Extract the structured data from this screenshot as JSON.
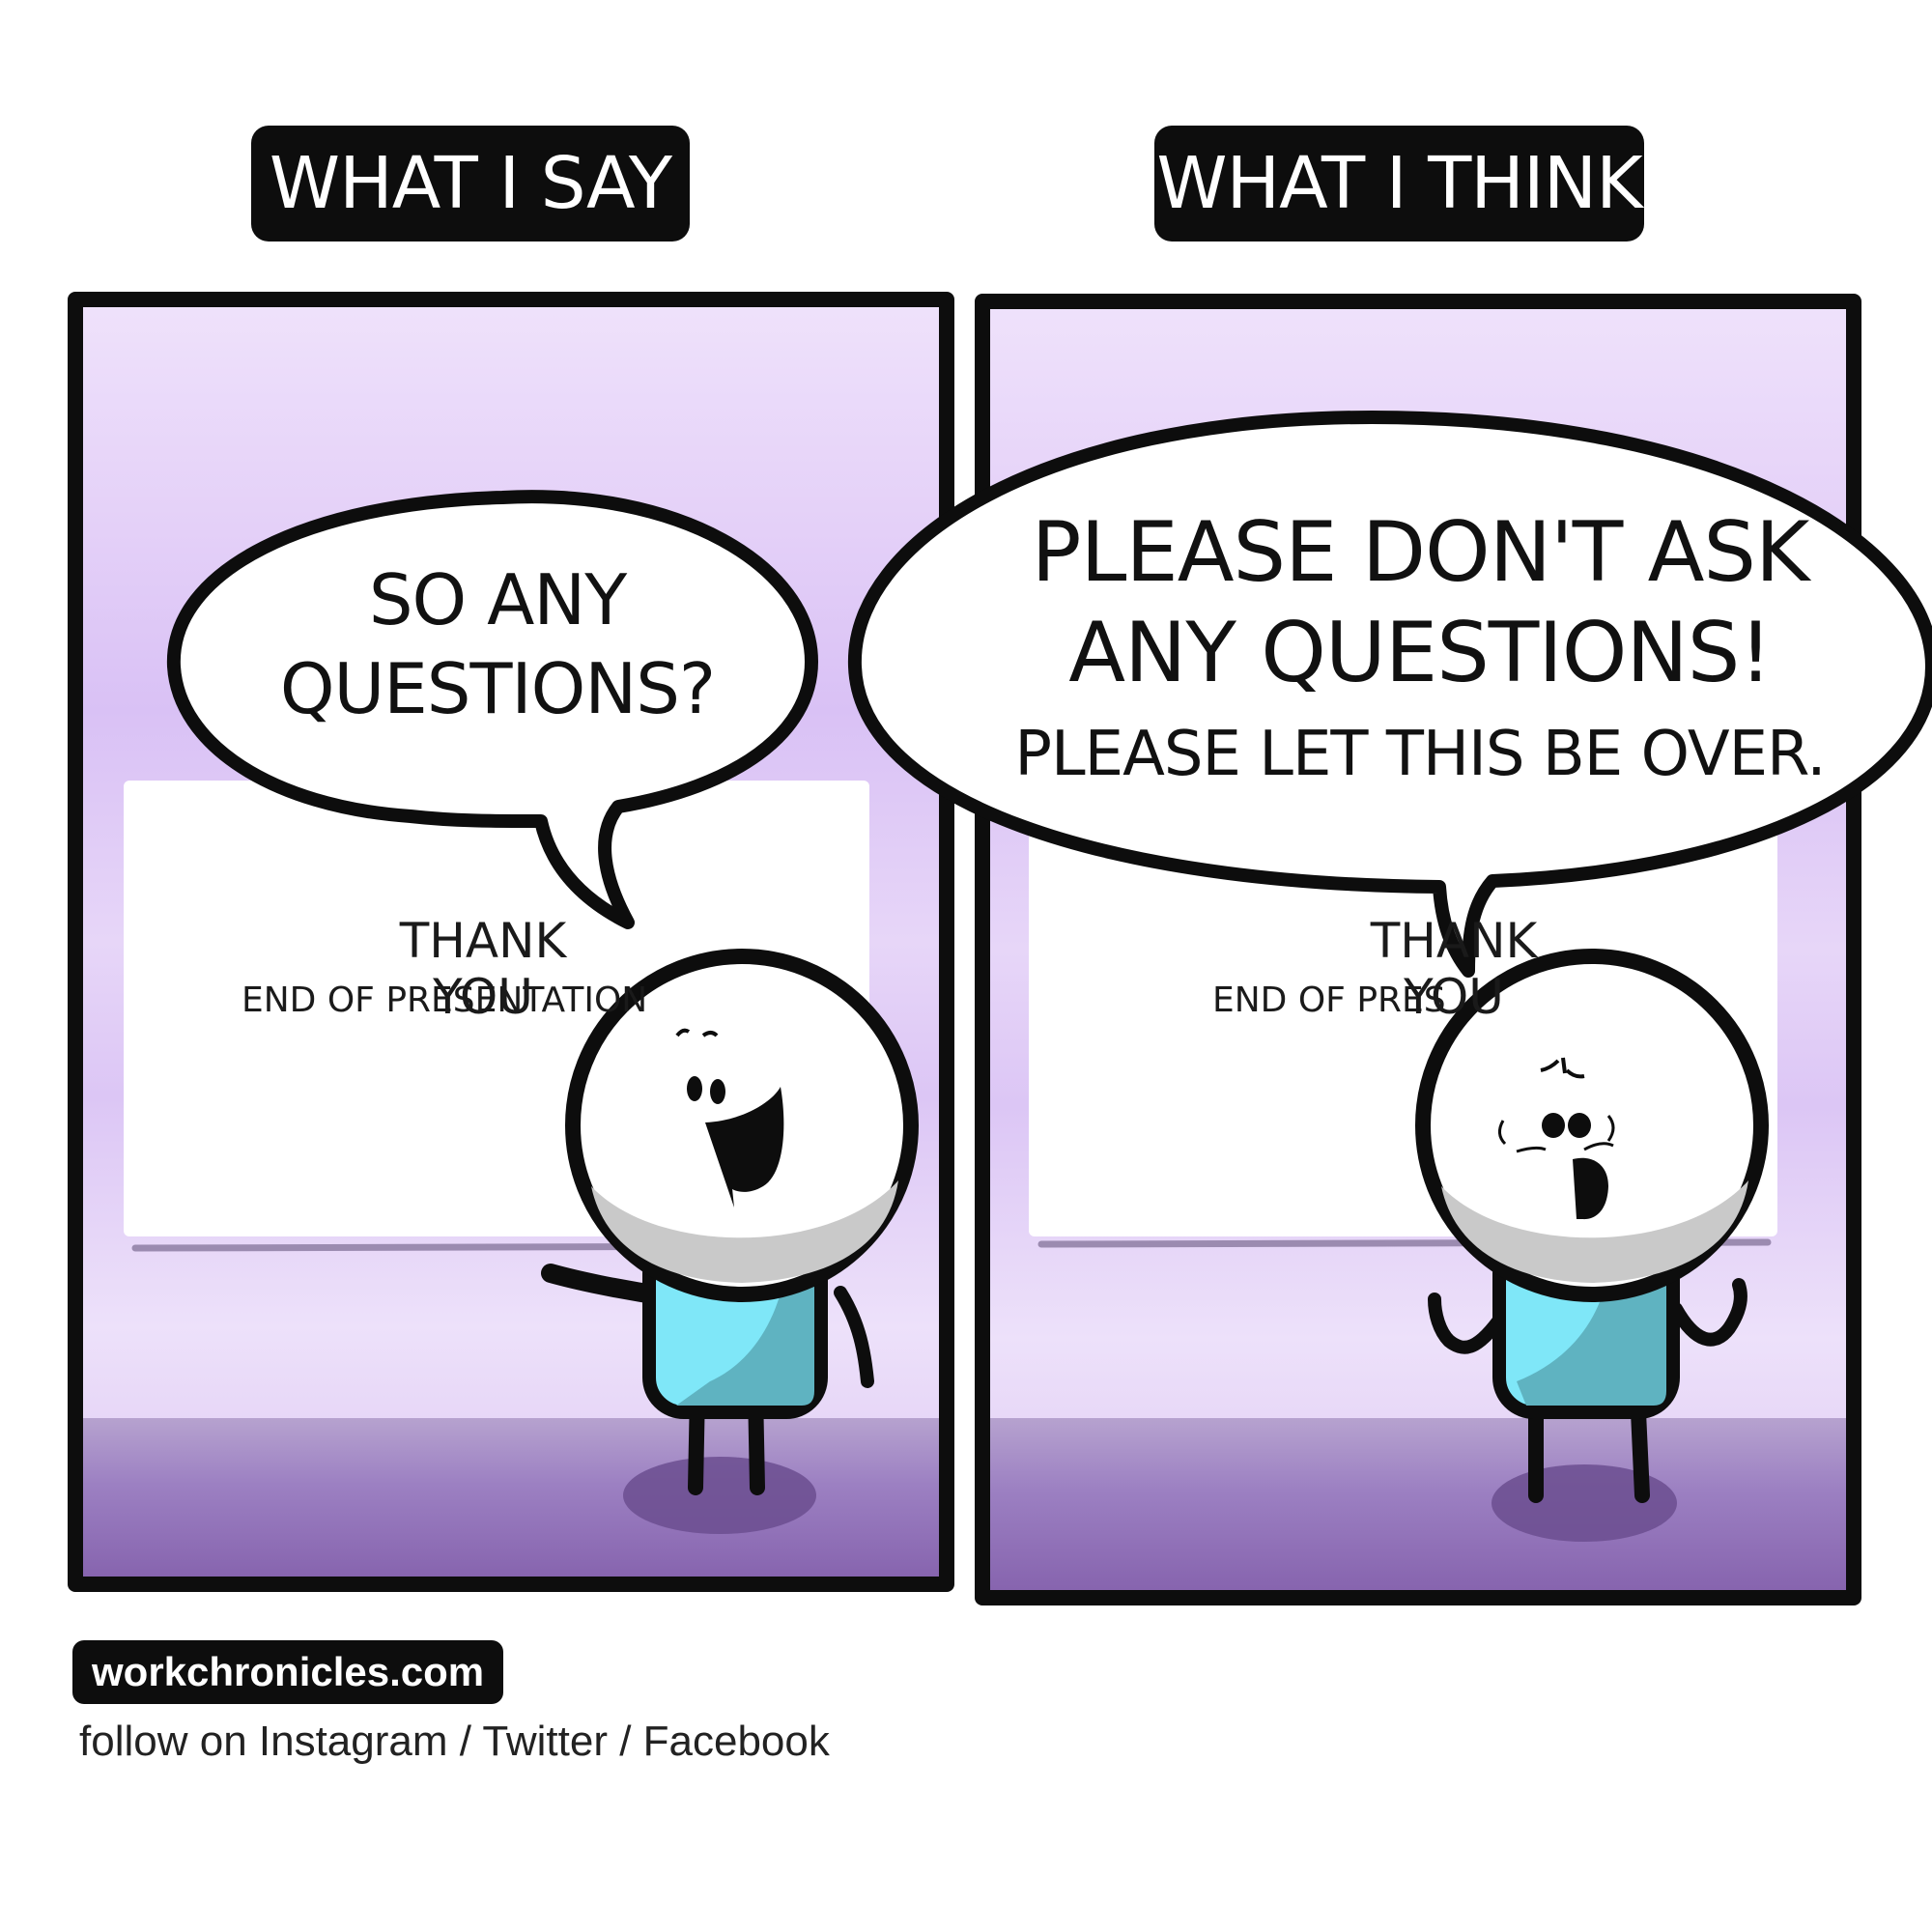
{
  "panels": {
    "left": {
      "caption": "WHAT I SAY",
      "bubble_text": "SO ANY QUESTIONS?",
      "slide_title": "THANK YOU",
      "slide_subtitle": "END OF PRESENTATION"
    },
    "right": {
      "caption": "WHAT I THINK",
      "bubble_line_1": "PLEASE DON'T ASK",
      "bubble_line_2": "ANY QUESTIONS!",
      "bubble_line_3": "PLEASE LET THIS BE OVER.",
      "slide_title": "THANK YOU",
      "slide_subtitle": "END OF PRESENTATION"
    }
  },
  "footer": {
    "site": "workchronicles.com",
    "follow": "follow on Instagram / Twitter / Facebook"
  },
  "colors": {
    "panel_light": "#efe3fb",
    "panel_mid": "#dcc6f6",
    "floor": "#8f6db3",
    "shirt": "#7fe7f8",
    "shirt_shade": "#5fb3c1",
    "outline": "#0d0d0d"
  }
}
